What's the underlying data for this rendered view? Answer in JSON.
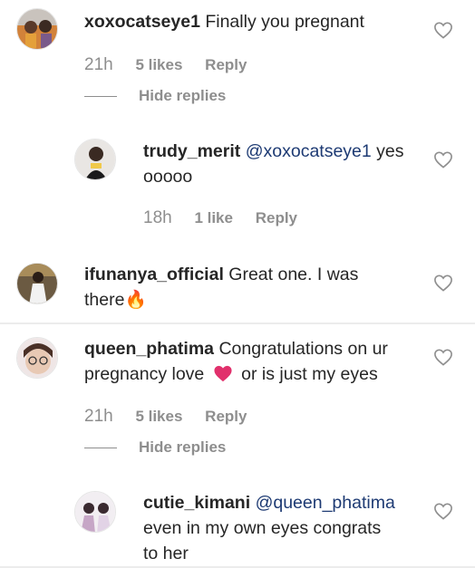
{
  "comments": [
    {
      "username": "xoxocatseye1",
      "text": "Finally you pregnant",
      "time": "21h",
      "likes": "5 likes",
      "reply": "Reply",
      "hide_replies": "Hide replies"
    },
    {
      "username": "trudy_merit",
      "mention": "@xoxocatseye1",
      "text_line1": "yes",
      "text_line2": "ooooo",
      "time": "18h",
      "likes": "1 like",
      "reply": "Reply"
    },
    {
      "username": "ifunanya_official",
      "text_line1": "Great one. I was",
      "text_line2": "there🔥"
    },
    {
      "username": "queen_phatima",
      "text_line1": "Congratulations on ur",
      "text_line2a": "pregnancy love",
      "text_line2b": "or is just my eyes",
      "time": "21h",
      "likes": "5 likes",
      "reply": "Reply",
      "hide_replies": "Hide replies"
    },
    {
      "username": "cutie_kimani",
      "mention": "@queen_phatima",
      "text_line2": "even in my own eyes congrats",
      "text_line3": "to her"
    }
  ],
  "colors": {
    "mention": "#1d3a73",
    "meta": "#8e8e8e",
    "heart_emoji": "#e1306c"
  },
  "icons": {
    "like": "heart-outline-icon"
  }
}
